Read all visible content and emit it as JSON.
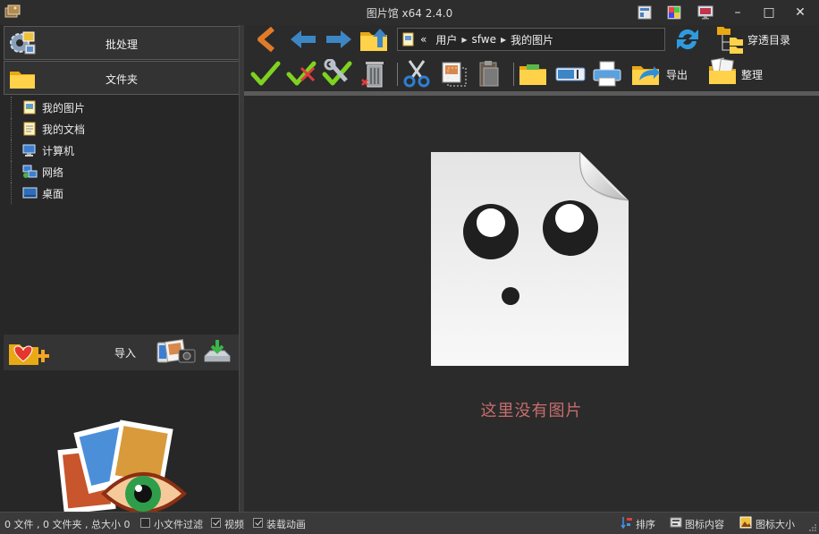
{
  "window": {
    "title": "图片馆 x64 2.4.0",
    "controls": {
      "minimize": "–",
      "maximize": "□",
      "close": "✕"
    }
  },
  "titlebar_buttons": [
    "layout-icon",
    "palette-icon",
    "monitor-icon"
  ],
  "sidebar": {
    "batch_label": "批处理",
    "folder_label": "文件夹",
    "tree": [
      {
        "label": "我的图片",
        "icon": "pictures-folder-icon"
      },
      {
        "label": "我的文档",
        "icon": "documents-folder-icon"
      },
      {
        "label": "计算机",
        "icon": "computer-icon"
      },
      {
        "label": "网络",
        "icon": "network-icon"
      },
      {
        "label": "桌面",
        "icon": "desktop-icon"
      }
    ],
    "import_label": "导入"
  },
  "toolbar": {
    "address": {
      "prefix": "«",
      "segments": [
        "用户",
        "sfwe",
        "我的图片"
      ]
    },
    "penetrate_label": "穿透目录",
    "export_label": "导出",
    "organize_label": "整理"
  },
  "main": {
    "empty_message": "这里没有图片"
  },
  "statusbar": {
    "summary": "0 文件 , 0 文件夹 , 总大小 0",
    "options": [
      {
        "label": "小文件过滤",
        "checked": false
      },
      {
        "label": "视频",
        "checked": true
      },
      {
        "label": "装载动画",
        "checked": true
      }
    ],
    "sort_label": "排序",
    "icon_content_label": "图标内容",
    "icon_size_label": "图标大小"
  },
  "colors": {
    "background": "#2b2b2b",
    "empty_message": "#c76d6d",
    "check_green": "#7ed321",
    "arrow_orange": "#e07b2a",
    "arrow_blue": "#3d86c6"
  }
}
